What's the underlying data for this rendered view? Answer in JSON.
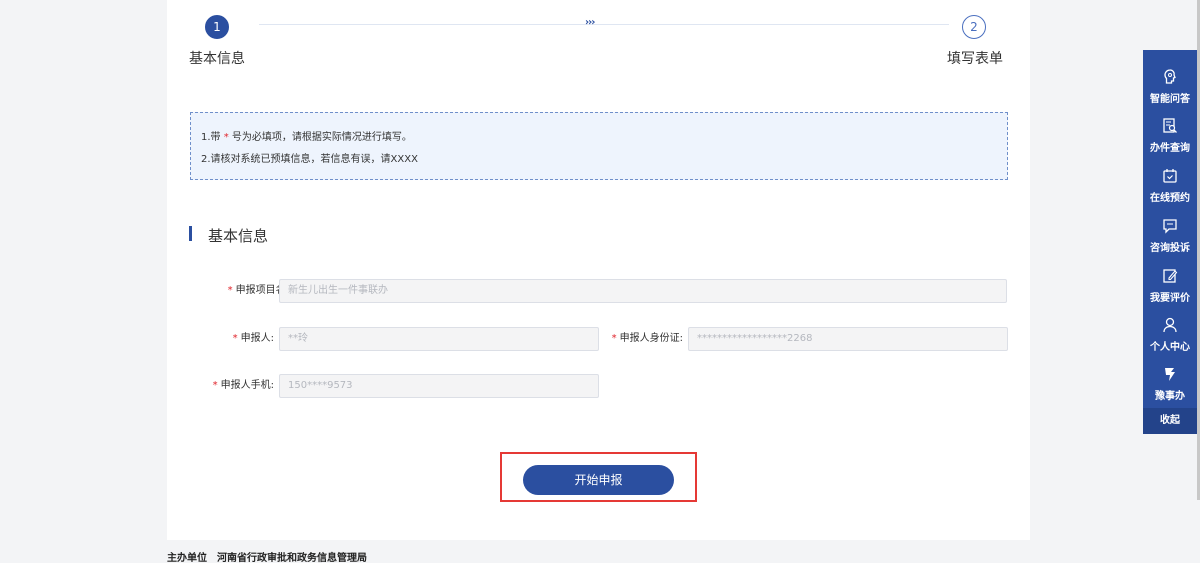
{
  "stepper": {
    "step1": {
      "number": "1",
      "label": "基本信息"
    },
    "step2": {
      "number": "2",
      "label": "填写表单"
    },
    "arrows": "›››"
  },
  "notice": {
    "line1_prefix": "1.带 ",
    "line1_star": "*",
    "line1_suffix": " 号为必填项，请根据实际情况进行填写。",
    "line2": "2.请核对系统已预填信息，若信息有误，请XXXX"
  },
  "section": {
    "title": "基本信息"
  },
  "form": {
    "required_mark": "*",
    "project_name": {
      "label": "申报项目名称:",
      "value": "新生儿出生一件事联办"
    },
    "applicant": {
      "label": "申报人:",
      "value": "**玲"
    },
    "id_card": {
      "label": "申报人身份证:",
      "value": "******************2268"
    },
    "phone": {
      "label": "申报人手机:",
      "value": "150****9573"
    }
  },
  "submit": {
    "label": "开始申报"
  },
  "footer": {
    "host_label": "主办单位",
    "host_value": "河南省行政审批和政务信息管理局"
  },
  "side_panel": {
    "items": [
      {
        "label": "智能问答",
        "icon": "brain-icon"
      },
      {
        "label": "办件查询",
        "icon": "search-doc-icon"
      },
      {
        "label": "在线预约",
        "icon": "calendar-icon"
      },
      {
        "label": "咨询投诉",
        "icon": "chat-icon"
      },
      {
        "label": "我要评价",
        "icon": "edit-icon"
      },
      {
        "label": "个人中心",
        "icon": "user-icon"
      },
      {
        "label": "豫事办",
        "icon": "yushiban-icon"
      }
    ],
    "collapse_label": "收起"
  },
  "colors": {
    "primary": "#2b4fa0",
    "required": "#e0242b",
    "highlight": "#e53935"
  }
}
